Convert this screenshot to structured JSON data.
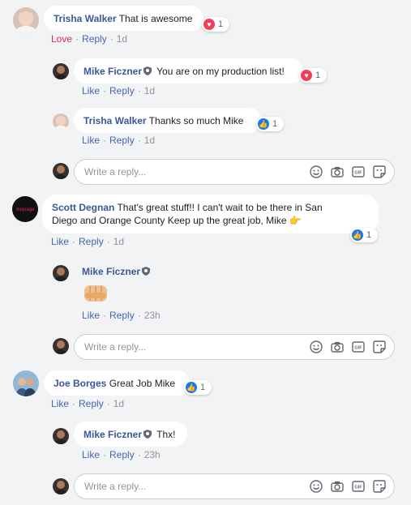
{
  "comments": [
    {
      "name": "Trisha Walker",
      "text": "That is awesome",
      "love": "Love",
      "reply": "Reply",
      "time": "1d",
      "react_count": "1"
    },
    {
      "name": "Mike Ficzner",
      "text": "You are on my production list!",
      "like": "Like",
      "reply": "Reply",
      "time": "1d",
      "react_count": "1"
    },
    {
      "name": "Trisha Walker",
      "text": "Thanks so much Mike",
      "like": "Like",
      "reply": "Reply",
      "time": "1d",
      "react_count": "1"
    },
    {
      "name": "Scott Degnan",
      "text": "That's great stuff!! I can't wait to be there in San",
      "text2": "Diego and Orange County Keep up the great job, Mike",
      "like": "Like",
      "reply": "Reply",
      "time": "1d",
      "react_count": "1",
      "avatar_text": "mixpage"
    },
    {
      "name": "Mike Ficzner",
      "like": "Like",
      "reply": "Reply",
      "time": "23h"
    },
    {
      "name": "Joe Borges",
      "text": "Great Job Mike",
      "like": "Like",
      "reply": "Reply",
      "time": "1d",
      "react_count": "1"
    },
    {
      "name": "Mike Ficzner",
      "text": "Thx!",
      "like": "Like",
      "reply": "Reply",
      "time": "23h"
    }
  ],
  "reply_box": {
    "placeholder": "Write a reply..."
  },
  "reply_icons": [
    "emoji-icon",
    "camera-icon",
    "gif-icon",
    "sticker-icon"
  ],
  "gif_label": "GIF",
  "colors": {
    "link": "#385898",
    "like": "#1877f2",
    "love": "#f33e58",
    "bg": "#f2f3f5"
  }
}
